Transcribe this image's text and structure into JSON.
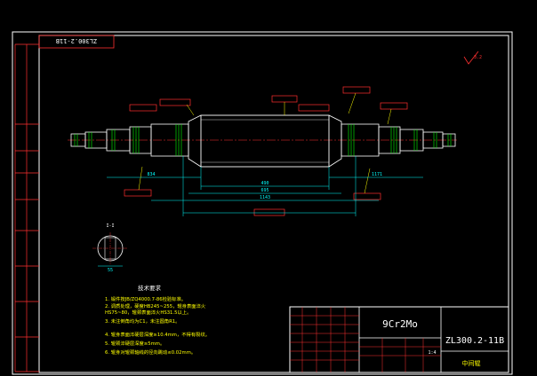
{
  "title_block": {
    "material": "9Cr2Mo",
    "drawing_number": "ZL300.2-11B",
    "part_name": "中间辊",
    "scale": "1:4"
  },
  "top_left_stamp": "ZL300.2-11B",
  "surface_mark": "3.2",
  "section_label": "I-I",
  "section_dim": "55",
  "notes": {
    "heading": "技术要求",
    "items": [
      "1. 锻件按JB/ZQ4000.7-86检验标准。",
      "2. 调质处理，硬度HB245~255，辊身表面淬火",
      "   HS75~80，辊颈表面淬火HS31.5以上。",
      "3. 未注倒角均为C1，未注圆角R1。",
      "4. 辊身表面淬硬层深度≥10.4mm，不得有裂纹。",
      "5. 辊颈淬硬层深度≥5mm。",
      "6. 辊身对辊颈轴线的径向跳动≤0.02mm。"
    ]
  },
  "dimensions": {
    "d1": "490",
    "d2": "695",
    "d3": "1143",
    "d4": "834",
    "d5": "1171"
  },
  "colors": {
    "frame": "#ffffff",
    "outline": "#ffffff",
    "dimension": "#00ffff",
    "annotation": "#ff3030",
    "highlight": "#ffff00",
    "hatch": "#00ff00",
    "centerline": "#ff3030"
  }
}
